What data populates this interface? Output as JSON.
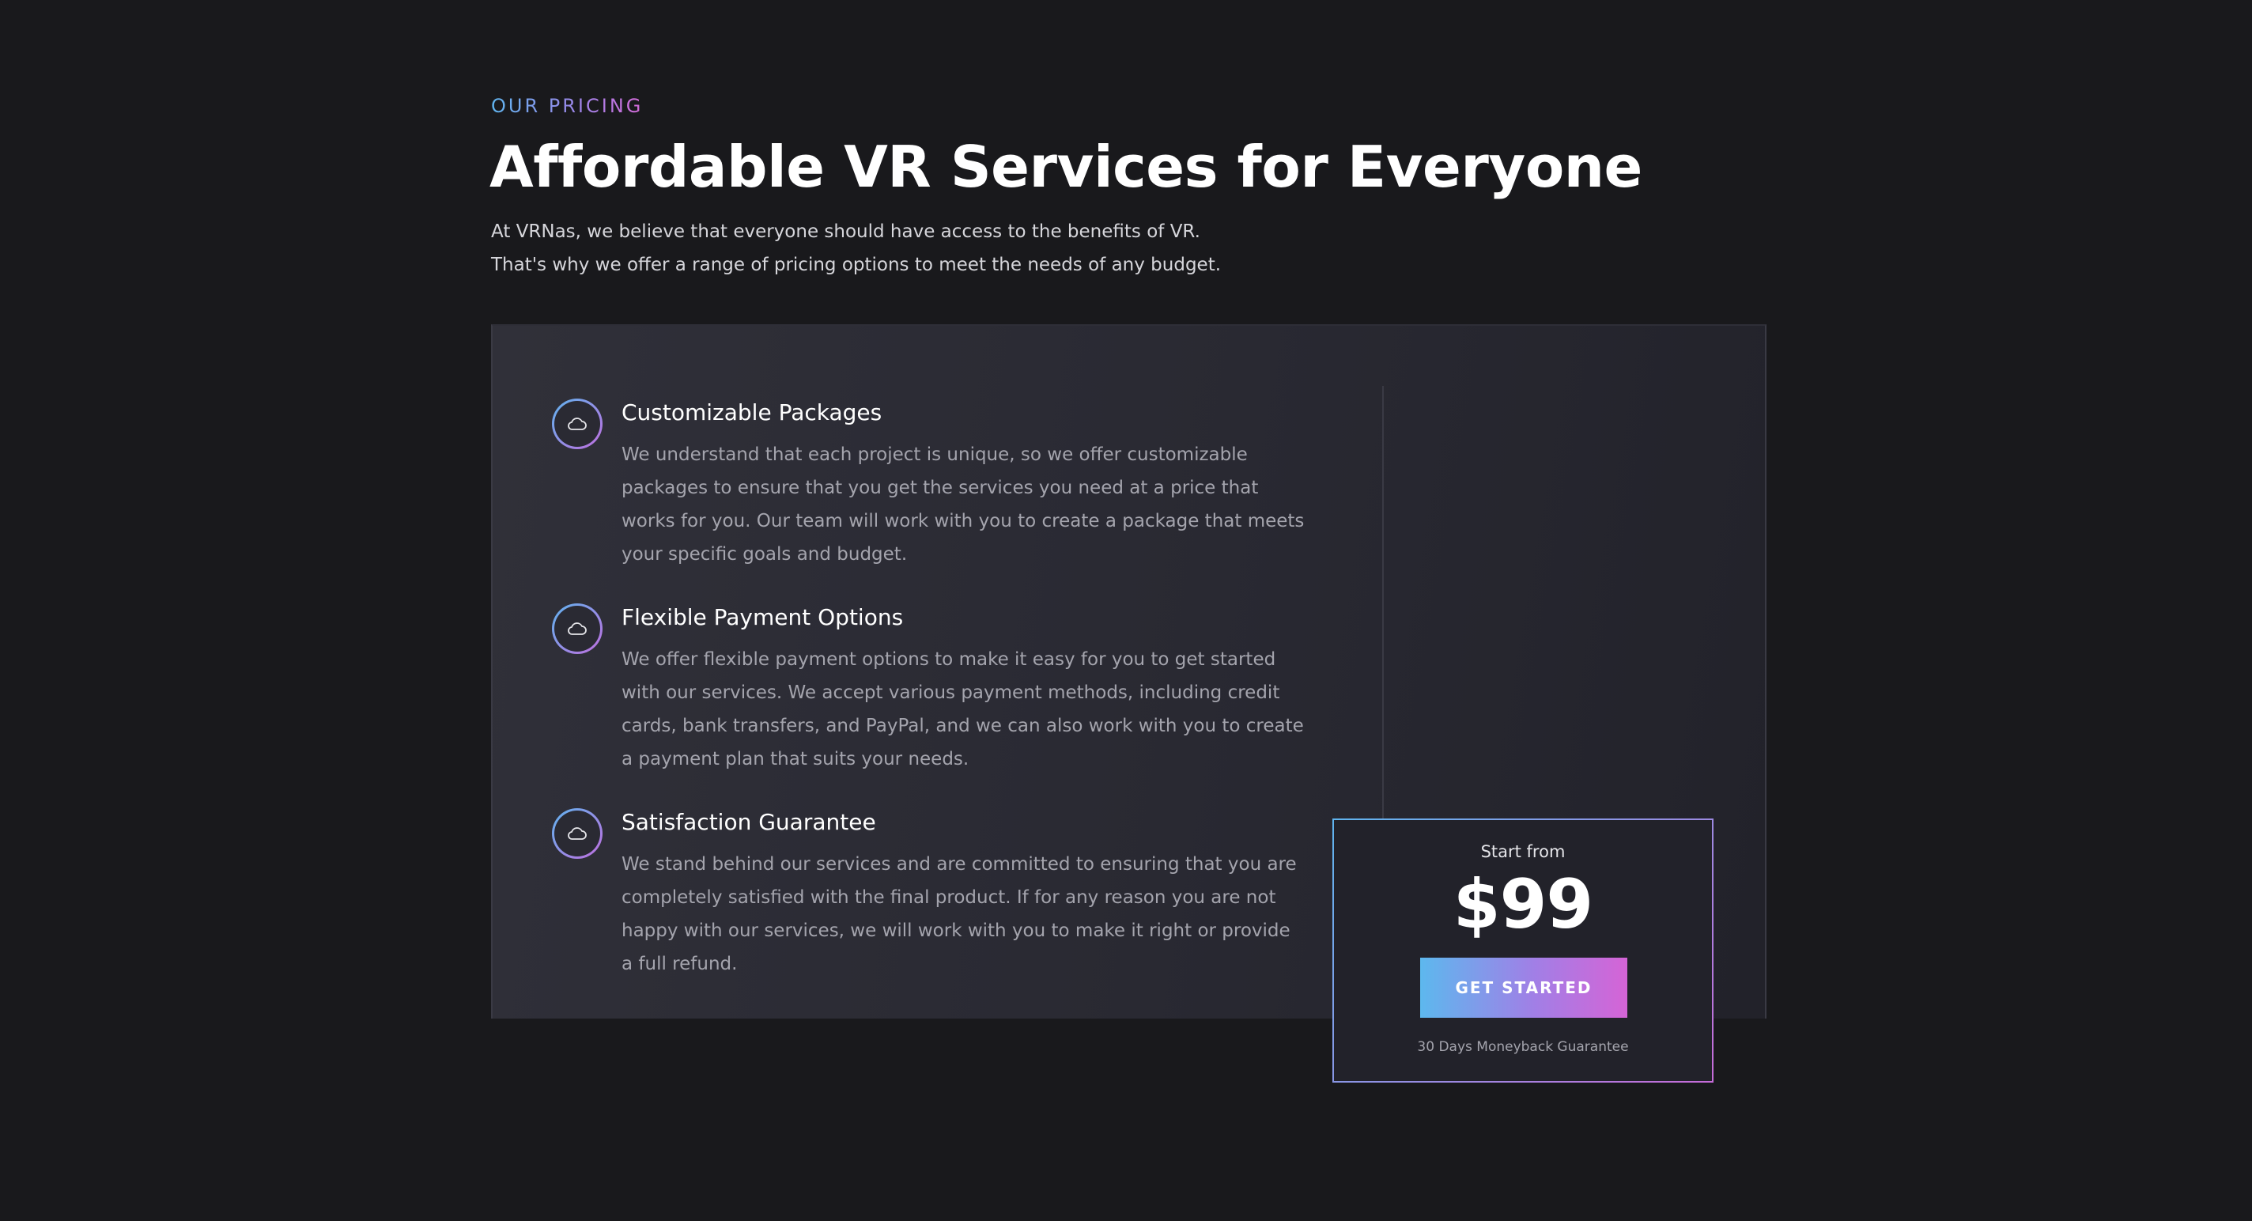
{
  "header": {
    "eyebrow": "OUR PRICING",
    "title": "Affordable VR Services for Everyone",
    "subtitle": "At VRNas, we believe that everyone should have access to the benefits of VR. That's why we offer a range of pricing options to meet the needs of any budget."
  },
  "features": [
    {
      "icon": "cloud-icon",
      "title": "Customizable Packages",
      "description": "We understand that each project is unique, so we offer customizable packages to ensure that you get the services you need at a price that works for you. Our team will work with you to create a package that meets your specific goals and budget."
    },
    {
      "icon": "cloud-icon",
      "title": "Flexible Payment Options",
      "description": "We offer flexible payment options to make it easy for you to get started with our services. We accept various payment methods, including credit cards, bank transfers, and PayPal, and we can also work with you to create a payment plan that suits your needs."
    },
    {
      "icon": "cloud-icon",
      "title": "Satisfaction Guarantee",
      "description": "We stand behind our services and are committed to ensuring that you are completely satisfied with the final product. If for any reason you are not happy with our services, we will work with you to make it right or provide a full refund."
    }
  ],
  "pricing": {
    "start_label": "Start from",
    "price": "$99",
    "cta_label": "GET STARTED",
    "guarantee": "30 Days Moneyback Guarantee"
  },
  "colors": {
    "background": "#19191c",
    "panel": "#2a2a33",
    "gradient_start": "#5fb4ee",
    "gradient_end": "#d464d6",
    "muted_text": "#a4a4ad"
  }
}
